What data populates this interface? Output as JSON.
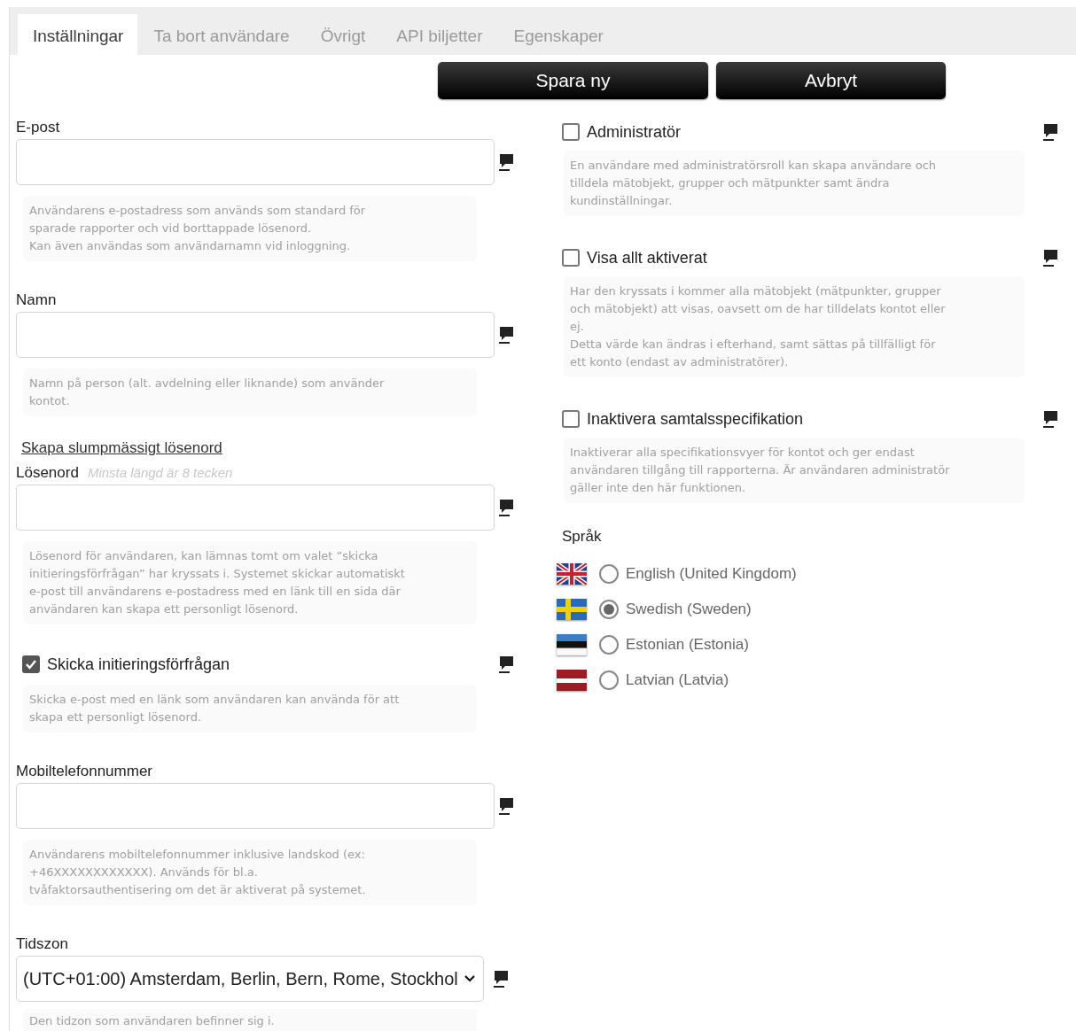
{
  "tabs": [
    {
      "label": "Inställningar",
      "selected": true
    },
    {
      "label": "Ta bort användare",
      "selected": false
    },
    {
      "label": "Övrigt",
      "selected": false
    },
    {
      "label": "API biljetter",
      "selected": false
    },
    {
      "label": "Egenskaper",
      "selected": false
    }
  ],
  "buttons": [
    {
      "label": "Spara ny"
    },
    {
      "label": "Avbryt"
    }
  ],
  "left_fields": [
    {
      "kind": "text",
      "label": "E-post",
      "help": "Användarens e-postadress som används som standard för\nsparade rapporter och vid borttappade lösenord.\nKan även användas som användarnamn vid inloggning."
    },
    {
      "kind": "text",
      "label": "Namn",
      "help": "Namn på person (alt. avdelning eller liknande) som använder\nkontot."
    },
    {
      "kind": "password",
      "link": "Skapa slumpmässigt lösenord",
      "label": "Lösenord",
      "hint": "Minsta längd är 8 tecken",
      "help": "Lösenord för användaren, kan lämnas tomt om valet ”skicka\ninitieringsförfrågan” har kryssats i. Systemet skickar automatiskt\ne-post till användarens e-postadress med en länk till en sida där\nanvändaren kan skapa ett personligt lösenord."
    },
    {
      "kind": "checkbox",
      "label": "Skicka initieringsförfrågan",
      "checked": true,
      "help": "Skicka e-post med en länk som användaren kan använda för att\nskapa ett personligt lösenord."
    },
    {
      "kind": "text",
      "label": "Mobiltelefonnummer",
      "help": "Användarens mobiltelefonnummer inklusive landskod (ex:\n+46XXXXXXXXXXXX). Används för bl.a.\ntvåfaktorsauthentisering om det är aktiverat på systemet."
    },
    {
      "kind": "select",
      "label": "Tidszon",
      "value": "(UTC+01:00) Amsterdam, Berlin, Bern, Rome, Stockhol",
      "help": "Den tidzon som användaren befinner sig i."
    }
  ],
  "right_options": [
    {
      "label": "Administratör",
      "checked": false,
      "help": "En användare med administratörsroll kan skapa användare och\ntilldela mätobjekt, grupper och mätpunkter samt ändra\nkundinställningar."
    },
    {
      "label": "Visa allt aktiverat",
      "checked": false,
      "help": "Har den kryssats i kommer alla mätobjekt (mätpunkter, grupper\noch mätobjekt) att visas, oavsett om de har tilldelats kontot eller\nej.\nDetta värde kan ändras i efterhand, samt sättas på tillfälligt för\nett konto (endast av administratörer)."
    },
    {
      "label": "Inaktivera samtalsspecifikation",
      "checked": false,
      "help": "Inaktiverar alla specifikationsvyer för kontot och ger endast\nanvändaren tillgång till rapporterna. Är användaren administratör\ngäller inte den här funktionen."
    }
  ],
  "language": {
    "label": "Språk",
    "options": [
      {
        "kind": "uk",
        "label": "English (United Kingdom)",
        "selected": false
      },
      {
        "kind": "se",
        "label": "Swedish (Sweden)",
        "selected": true
      },
      {
        "kind": "ee",
        "label": "Estonian (Estonia)",
        "selected": false
      },
      {
        "kind": "lv",
        "label": "Latvian (Latvia)",
        "selected": false
      }
    ]
  }
}
